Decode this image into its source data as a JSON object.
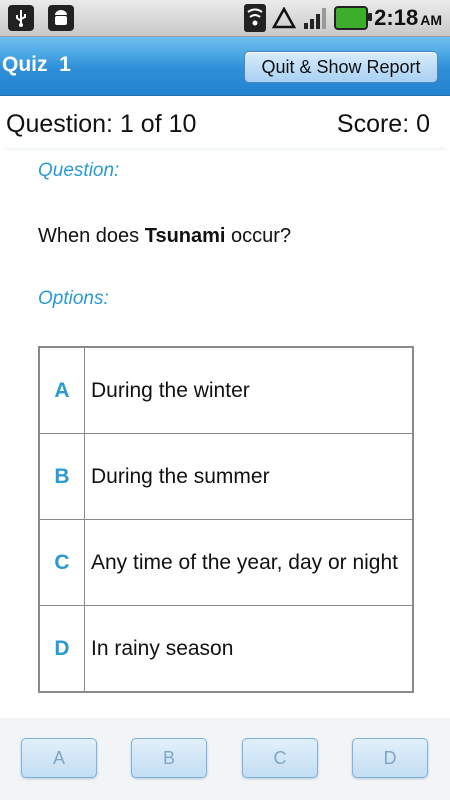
{
  "status_bar": {
    "time": "2:18",
    "ampm": "AM",
    "icons": [
      "usb-icon",
      "android-icon",
      "wifi-icon",
      "triangle-icon",
      "signal-icon",
      "battery-icon"
    ]
  },
  "header": {
    "title": "Quiz  1",
    "quit_button": "Quit & Show Report",
    "accent_color": "#2e8fd8"
  },
  "progress": {
    "question_label": "Question: 1 of 10",
    "score_label": "Score: 0"
  },
  "main": {
    "question_heading": "Question:",
    "question_prefix": "When does ",
    "question_bold": "Tsunami",
    "question_suffix": " occur?",
    "options_heading": "Options:",
    "options": [
      {
        "letter": "A",
        "text": "During the winter"
      },
      {
        "letter": "B",
        "text": "During the summer"
      },
      {
        "letter": "C",
        "text": "Any time of the year, day or night"
      },
      {
        "letter": "D",
        "text": "In rainy season"
      }
    ]
  },
  "answer_buttons": [
    "A",
    "B",
    "C",
    "D"
  ]
}
